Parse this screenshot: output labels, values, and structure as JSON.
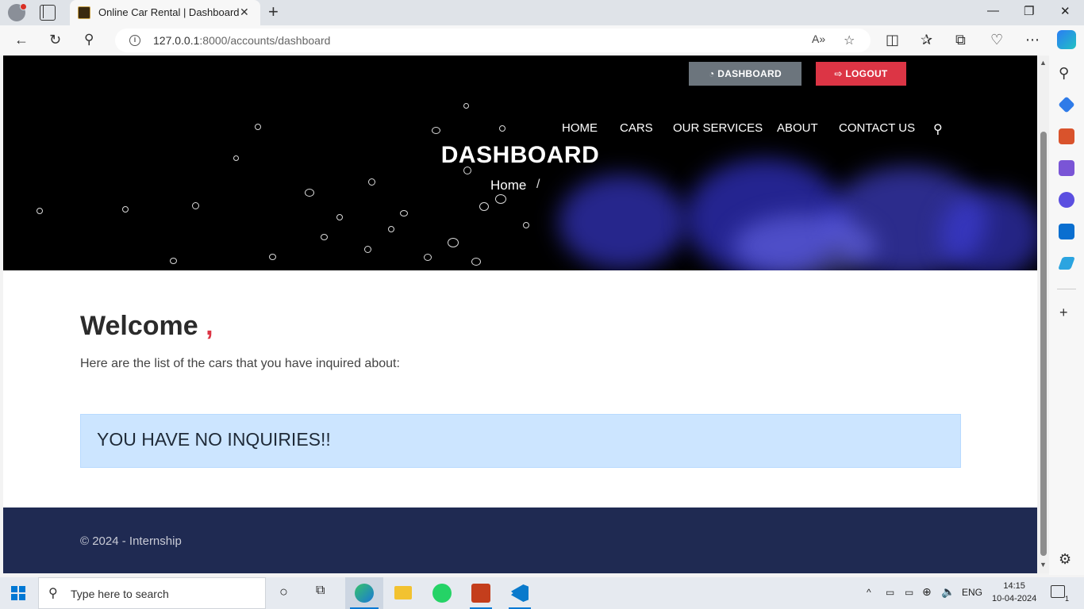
{
  "browser": {
    "tab_title": "Online Car Rental | Dashboard",
    "url_host": "127.0.0.1",
    "url_rest": ":8000/accounts/dashboard"
  },
  "header": {
    "dashboard_button": "DASHBOARD",
    "logout_button": "LOGOUT"
  },
  "nav": {
    "items": [
      "HOME",
      "CARS",
      "OUR SERVICES",
      "ABOUT",
      "CONTACT US"
    ]
  },
  "hero": {
    "title": "DASHBOARD",
    "breadcrumb_home": "Home",
    "breadcrumb_sep": "/"
  },
  "main": {
    "welcome": "Welcome",
    "welcome_comma": ",",
    "subtext": "Here are the list of the cars that you have inquired about:",
    "alert": "YOU HAVE NO INQUIRIES!!"
  },
  "footer": {
    "text": "© 2024 - Internship"
  },
  "taskbar": {
    "search_placeholder": "Type here to search",
    "language": "ENG",
    "time": "14:15",
    "date": "10-04-2024",
    "notification_count": "1"
  },
  "colors": {
    "dashboard_btn": "#6c757d",
    "logout_btn": "#dc3545",
    "alert_bg": "#cce5ff",
    "footer_bg": "#1f2a52"
  }
}
